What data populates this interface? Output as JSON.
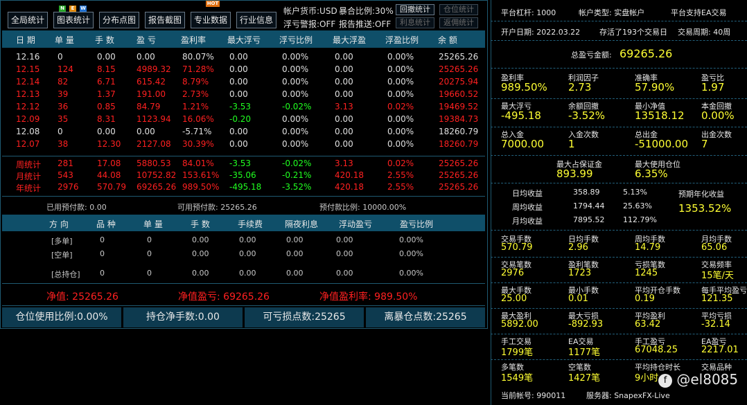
{
  "toolbar": {
    "buttons": [
      "全局统计",
      "图表统计",
      "分布点图",
      "报告截图",
      "专业数据",
      "行业信息"
    ],
    "new_badge": [
      "N",
      "E",
      "W"
    ],
    "hot_badge": "HOT",
    "account_currency": "帐户货币:USD",
    "exposure_ratio": "暴合比例:30%",
    "float_loss_warn": "浮亏警报:OFF",
    "report_push": "报告推送:OFF",
    "small_buttons": [
      "回撤统计",
      "仓位统计",
      "利息统计",
      "返佣统计"
    ]
  },
  "table": {
    "headers": [
      "日 期",
      "单 量",
      "手 数",
      "盈 亏",
      "盈利率",
      "最大浮亏",
      "浮亏比例",
      "最大浮盈",
      "浮盈比例",
      "余 额"
    ],
    "rows": [
      {
        "color": "wht",
        "cells": [
          "12.16",
          "0",
          "0.00",
          "0.00",
          "80.07%",
          "0.00",
          "0.00%",
          "0.00",
          "0.00%",
          "25265.26"
        ]
      },
      {
        "color": "red",
        "cells": [
          "12.15",
          "124",
          "8.15",
          "4989.32",
          "71.28%",
          "0.00",
          "0.00%",
          "0.00",
          "0.00%",
          "25265.26"
        ]
      },
      {
        "color": "red",
        "cells": [
          "12.14",
          "82",
          "6.71",
          "615.42",
          "8.79%",
          "0.00",
          "0.00%",
          "0.00",
          "0.00%",
          "20275.94"
        ]
      },
      {
        "color": "red",
        "cells": [
          "12.13",
          "39",
          "1.37",
          "191.00",
          "2.73%",
          "0.00",
          "0.00%",
          "0.00",
          "0.00%",
          "19660.52"
        ]
      },
      {
        "color": "red",
        "cells": [
          "12.12",
          "36",
          "0.85",
          "84.79",
          "1.21%",
          "-3.53",
          "-0.02%",
          "3.13",
          "0.02%",
          "19469.52"
        ]
      },
      {
        "color": "red",
        "cells": [
          "12.09",
          "35",
          "8.31",
          "1123.94",
          "16.06%",
          "-0.20",
          "0.00%",
          "0.00",
          "0.00%",
          "19384.73"
        ]
      },
      {
        "color": "wht",
        "cells": [
          "12.08",
          "0",
          "0.00",
          "0.00",
          "-5.71%",
          "0.00",
          "0.00%",
          "0.00",
          "0.00%",
          "18260.79"
        ]
      },
      {
        "color": "red",
        "cells": [
          "12.07",
          "38",
          "12.30",
          "2127.08",
          "30.39%",
          "0.00",
          "0.00%",
          "0.00",
          "0.00%",
          "18260.79"
        ]
      }
    ],
    "summary": [
      {
        "cells": [
          "周统计",
          "281",
          "17.08",
          "5880.53",
          "84.01%",
          "-3.53",
          "-0.02%",
          "3.13",
          "0.02%",
          "25265.26"
        ]
      },
      {
        "cells": [
          "月统计",
          "543",
          "44.08",
          "10752.82",
          "153.61%",
          "-35.06",
          "-0.21%",
          "420.18",
          "2.55%",
          "25265.26"
        ]
      },
      {
        "cells": [
          "年统计",
          "2976",
          "570.79",
          "69265.26",
          "989.50%",
          "-495.18",
          "-3.52%",
          "420.18",
          "2.55%",
          "25265.26"
        ]
      }
    ],
    "margin_info": [
      "已用预付款: 0.00",
      "可用预付款: 25265.26",
      "预付款比例: 10000.00%"
    ]
  },
  "positions": {
    "headers": [
      "方 向",
      "品 种",
      "单 量",
      "手 数",
      "手续费",
      "隔夜利息",
      "浮动盈亏",
      "盈亏比例"
    ],
    "rows": [
      [
        "[多单]",
        "0",
        "0",
        "0.00",
        "0.00",
        "0.00",
        "0.00",
        "0.00%"
      ],
      [
        "[空单]",
        "0",
        "0",
        "0.00",
        "0.00",
        "0.00",
        "0.00",
        "0.00%"
      ],
      [
        "[总持仓]",
        "0",
        "0",
        "0.00",
        "0.00",
        "0.00",
        "0.00",
        "0.00%"
      ]
    ],
    "totals": {
      "net": "净值: 25265.26",
      "net_pl": "净值盈亏: 69265.26",
      "net_rate": "净值盈利率: 989.50%"
    }
  },
  "footer": [
    "仓位使用比例:0.00%",
    "持仓净手数:0.00",
    "可亏损点数:25265",
    "离暴仓点数:25265"
  ],
  "right": {
    "leverage": "平台杠杆:  1000",
    "account_type": "帐户类型:  实盘帐户",
    "ea_support": "平台支持EA交易",
    "open_date": "开户日期:  2022.03.22",
    "survived": "存活了193个交易日",
    "cycle": "交易周期:  40周",
    "total_pl_label": "总盈亏金额:",
    "total_pl_value": "69265.26",
    "grid1": [
      {
        "label": "盈利率",
        "value": "989.50%"
      },
      {
        "label": "利润因子",
        "value": "2.73"
      },
      {
        "label": "准确率",
        "value": "57.90%"
      },
      {
        "label": "盈亏比",
        "value": "1.97"
      },
      {
        "label": "最大浮亏",
        "value": "-495.18"
      },
      {
        "label": "余额回撤",
        "value": "-3.52%"
      },
      {
        "label": "最小净值",
        "value": "13518.12"
      },
      {
        "label": "本金回撤",
        "value": "0.00%"
      },
      {
        "label": "总入金",
        "value": "7000.00"
      },
      {
        "label": "入金次数",
        "value": "1"
      },
      {
        "label": "总出金",
        "value": "-51000.00"
      },
      {
        "label": "出金次数",
        "value": "7"
      }
    ],
    "margin": [
      {
        "label": "最大占保证金",
        "value": "893.99"
      },
      {
        "label": "最大使用仓位",
        "value": "6.35%"
      }
    ],
    "avg": [
      {
        "label": "日均收益",
        "amount": "358.89",
        "pct": "5.13%"
      },
      {
        "label": "周均收益",
        "amount": "1794.44",
        "pct": "25.63%"
      },
      {
        "label": "月均收益",
        "amount": "7895.52",
        "pct": "112.79%"
      }
    ],
    "annual_label": "预期年化收益",
    "annual_value": "1353.52%",
    "grid2": [
      {
        "label": "交易手数",
        "value": "570.79"
      },
      {
        "label": "日均手数",
        "value": "2.96"
      },
      {
        "label": "周均手数",
        "value": "14.79"
      },
      {
        "label": "月均手数",
        "value": "65.06"
      },
      {
        "label": "交易笔数",
        "value": "2976"
      },
      {
        "label": "盈利笔数",
        "value": "1723"
      },
      {
        "label": "亏损笔数",
        "value": "1245"
      },
      {
        "label": "交易频率",
        "value": "15笔/天"
      },
      {
        "label": "最大手数",
        "value": "25.00"
      },
      {
        "label": "最小手数",
        "value": "0.01"
      },
      {
        "label": "平均开仓手数",
        "value": "0.19"
      },
      {
        "label": "每手平均盈亏",
        "value": "121.35"
      },
      {
        "label": "最大盈利",
        "value": "5892.00"
      },
      {
        "label": "最大亏损",
        "value": "-892.93"
      },
      {
        "label": "平均盈利",
        "value": "63.42"
      },
      {
        "label": "平均亏损",
        "value": "-32.14"
      },
      {
        "label": "手工交易",
        "value": "1799笔"
      },
      {
        "label": "EA交易",
        "value": "1177笔"
      },
      {
        "label": "手工盈亏",
        "value": "67048.25"
      },
      {
        "label": "EA盈亏",
        "value": "2217.01"
      },
      {
        "label": "多笔数",
        "value": "1549笔"
      },
      {
        "label": "空笔数",
        "value": "1427笔"
      },
      {
        "label": "平均持仓时长",
        "value": "9小时"
      },
      {
        "label": "交易品种",
        "value": ""
      }
    ],
    "account_no": "当前帐号:  990011",
    "server": "服务器:  SnapexFX-Live",
    "watermark": "@el8085"
  },
  "colors": {
    "header_bg": "#0f4f69",
    "red": "#ff2020",
    "green": "#20ff20",
    "yellow": "#ffff33"
  }
}
